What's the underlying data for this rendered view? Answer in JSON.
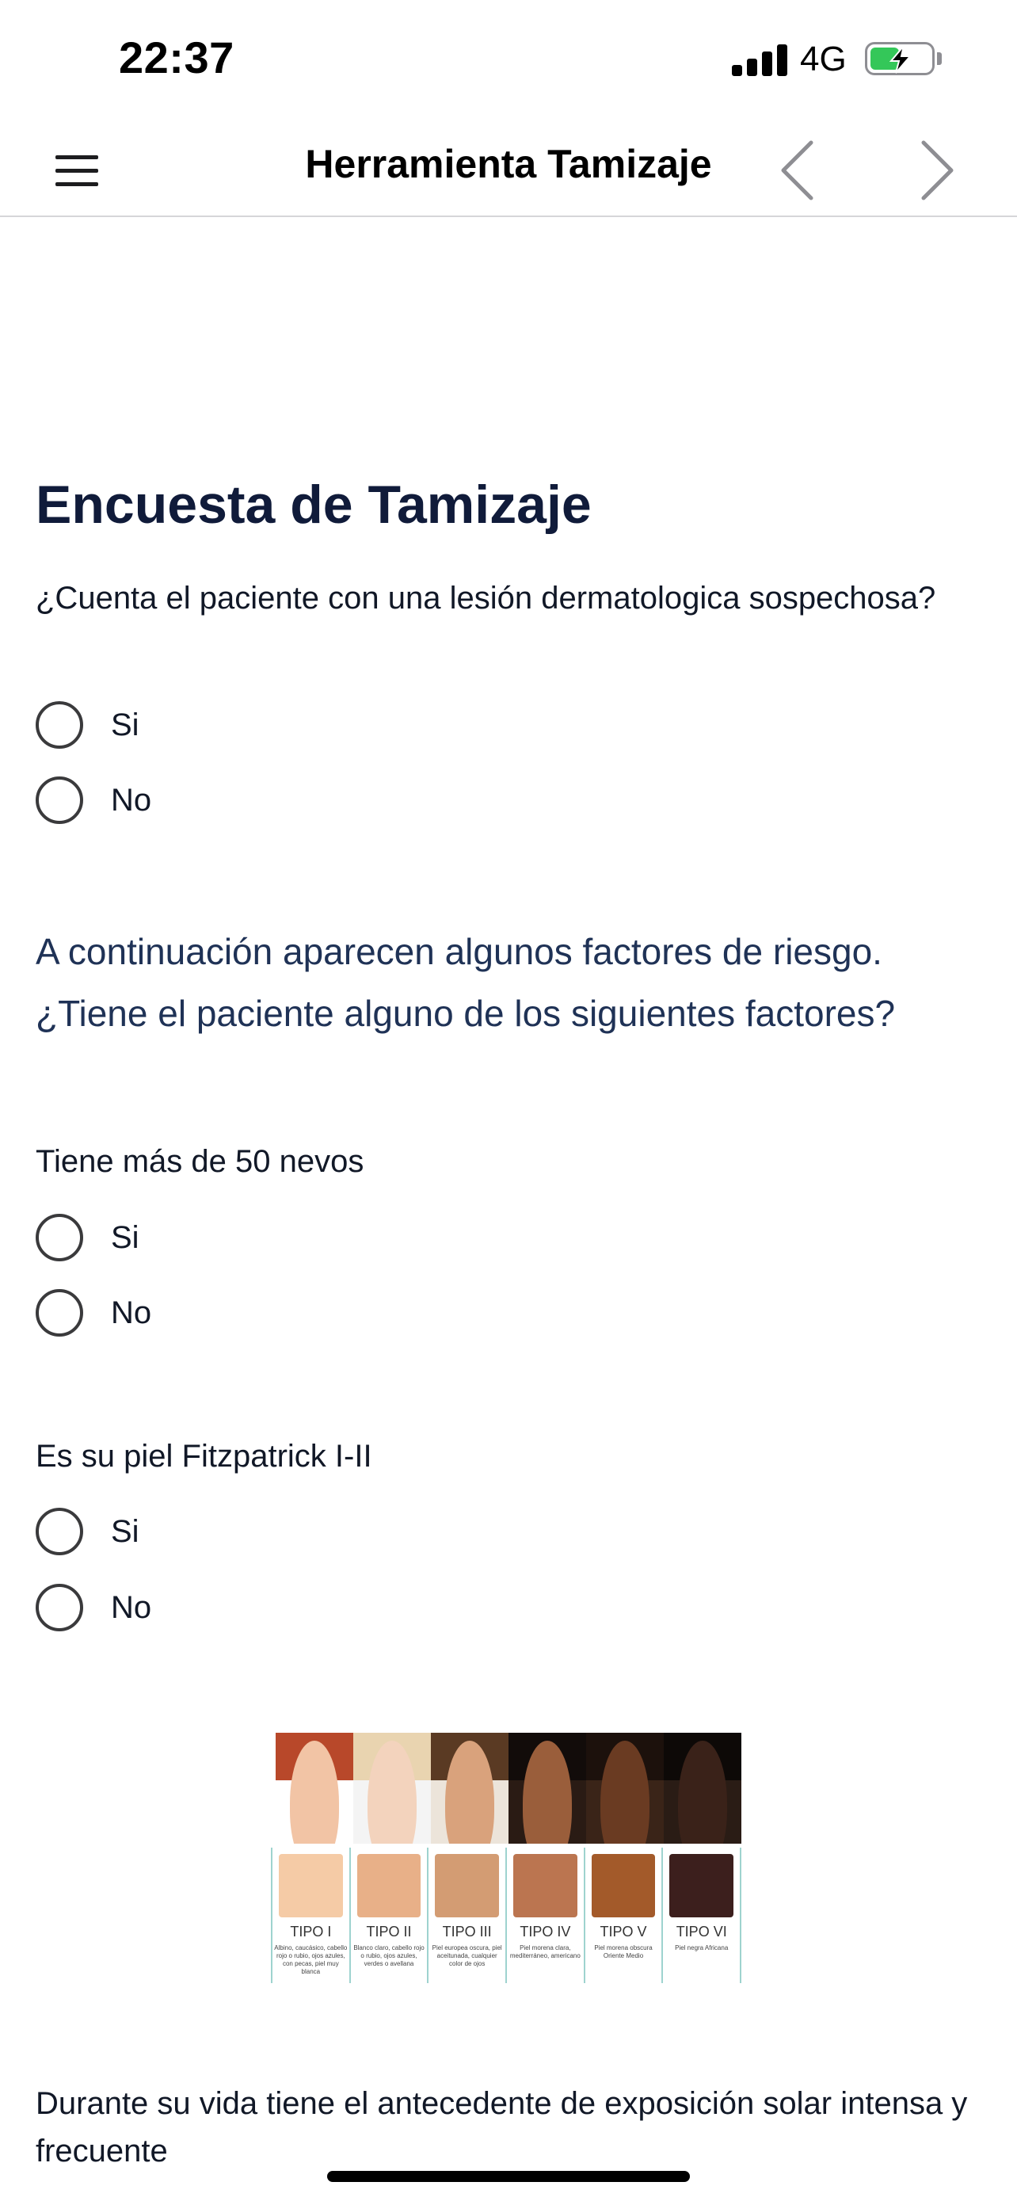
{
  "status_bar": {
    "time": "22:37",
    "network": "4G",
    "icons": [
      "signal-bars-icon",
      "battery-charging-icon"
    ]
  },
  "nav": {
    "title": "Herramienta Tamizaje",
    "icons": [
      "hamburger-menu-icon",
      "chevron-left-icon",
      "chevron-right-icon"
    ]
  },
  "survey": {
    "title": "Encuesta de Tamizaje",
    "q1": {
      "text": "¿Cuenta el paciente con una lesión dermatologica sospechosa?",
      "options": [
        "Si",
        "No"
      ]
    },
    "intro_line1": "A continuación aparecen algunos factores de riesgo.",
    "intro_line2": "¿Tiene el paciente alguno de los siguientes factores?",
    "q2": {
      "text": "Tiene más de 50 nevos",
      "options": [
        "Si",
        "No"
      ]
    },
    "q3": {
      "text": "Es su piel Fitzpatrick I-II",
      "options": [
        "Si",
        "No"
      ]
    },
    "q4": {
      "text": "Durante su vida tiene el antecedente de exposición solar intensa y frecuente"
    }
  },
  "fitzpatrick": {
    "types": [
      {
        "label": "TIPO I",
        "desc": "Albino, caucásico, cabello rojo o rubio, ojos azules, con pecas, piel muy blanca",
        "color": "#f5cba6"
      },
      {
        "label": "TIPO II",
        "desc": "Blanco claro, cabello rojo o rubio, ojos azules, verdes o avellana",
        "color": "#e8b088"
      },
      {
        "label": "TIPO III",
        "desc": "Piel europea oscura, piel aceitunada, cualquier color de ojos",
        "color": "#d39c73"
      },
      {
        "label": "TIPO IV",
        "desc": "Piel morena clara, mediterráneo, americano",
        "color": "#bb7550"
      },
      {
        "label": "TIPO  V",
        "desc": "Piel morena obscura Oriente Medio",
        "color": "#a35a2a"
      },
      {
        "label": "TIPO VI",
        "desc": "Piel negra Africana",
        "color": "#3c1f1d"
      }
    ],
    "face_colors": [
      {
        "skin": "#f2c4a5",
        "hair": "#b8482a",
        "bg": "#ffffff"
      },
      {
        "skin": "#f3d3bd",
        "hair": "#e9d4b0",
        "bg": "#f4f4f4"
      },
      {
        "skin": "#d9a27c",
        "hair": "#5a3a23",
        "bg": "#ece4da"
      },
      {
        "skin": "#9a5e3b",
        "hair": "#120c0a",
        "bg": "#2a1b14"
      },
      {
        "skin": "#6a3b22",
        "hair": "#1c110c",
        "bg": "#3a2418"
      },
      {
        "skin": "#3a2219",
        "hair": "#0d0907",
        "bg": "#2a1c15"
      }
    ]
  }
}
